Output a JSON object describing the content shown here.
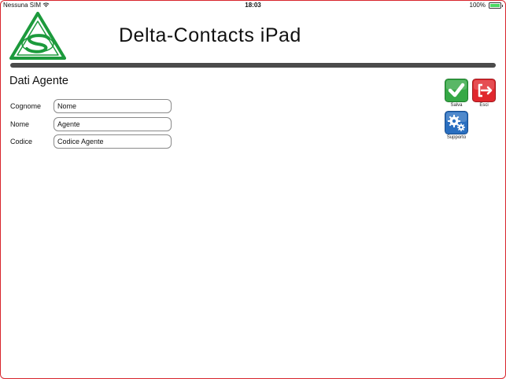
{
  "status_bar": {
    "carrier": "Nessuna SIM",
    "time": "18:03",
    "battery_percent": "100%"
  },
  "header": {
    "title": "Delta-Contacts iPad"
  },
  "section": {
    "title": "Dati Agente"
  },
  "form": {
    "fields": [
      {
        "label": "Cognome",
        "value": "Nome"
      },
      {
        "label": "Nome",
        "value": "Agente"
      },
      {
        "label": "Codice",
        "value": "Codice Agente"
      }
    ]
  },
  "actions": {
    "save_label": "Salva",
    "exit_label": "Esci",
    "support_label": "Supporto"
  },
  "colors": {
    "frame_border": "#d8242c",
    "logo_green": "#1c9a3c",
    "save_green": "#35a845",
    "exit_red": "#e0282e",
    "support_blue": "#2a6fc0",
    "header_bar": "#4b4b4b"
  }
}
